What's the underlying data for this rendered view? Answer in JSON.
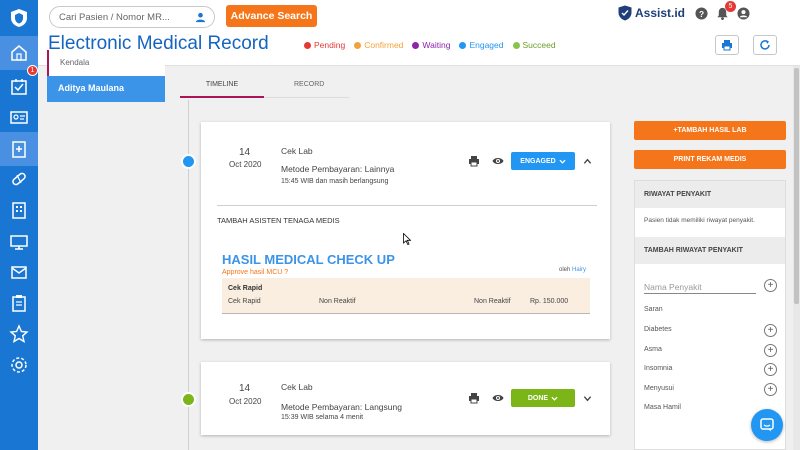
{
  "app": {
    "brand": "Assist.id"
  },
  "search": {
    "placeholder": "Cari Pasien / Nomor MR..."
  },
  "header": {
    "advance_search_label": "Advance Search",
    "title": "Electronic Medical Record",
    "legend": [
      {
        "label": "Pending",
        "color": "#e53935"
      },
      {
        "label": "Confirmed",
        "color": "#f5a13b"
      },
      {
        "label": "Waiting",
        "color": "#8e24aa"
      },
      {
        "label": "Engaged",
        "color": "#2196f3"
      },
      {
        "label": "Succeed",
        "color": "#8bc34a"
      }
    ],
    "notification_count": "5"
  },
  "sidebar": {
    "checklist_badge": "1"
  },
  "patients": [
    {
      "name": "Kendala"
    },
    {
      "name": "Aditya Maulana"
    }
  ],
  "tabs": [
    {
      "label": "TIMELINE"
    },
    {
      "label": "RECORD"
    }
  ],
  "visits": [
    {
      "day": "14",
      "month_year": "Oct 2020",
      "title": "Cek Lab",
      "payment": "Metode Pembayaran: Lainnya",
      "time_note": "15:45 WIB dan masih berlangsung",
      "status": "ENGAGED",
      "status_color": "#2196f3",
      "assist_label": "TAMBAH ASISTEN TENAGA MEDIS",
      "mcu": {
        "title": "HASIL MEDICAL CHECK UP",
        "approve": "Approve hasil MCU ?",
        "by_label": "oleh",
        "by_name": "Hairy",
        "header": "Cek Rapid",
        "row": {
          "test": "Cek Rapid",
          "result": "Non Reaktif",
          "reference": "Non Reaktif",
          "price": "Rp. 150.000"
        }
      }
    },
    {
      "day": "14",
      "month_year": "Oct 2020",
      "title": "Cek Lab",
      "payment": "Metode Pembayaran: Langsung",
      "time_note": "15:39 WIB selama 4 menit",
      "status": "DONE",
      "status_color": "#7cb518"
    }
  ],
  "right_panel": {
    "add_result_label": "+TAMBAH HASIL LAB",
    "print_label": "PRINT REKAM MEDIS",
    "history_title": "RIWAYAT PENYAKIT",
    "history_empty": "Pasien tidak memiliki riwayat penyakit.",
    "add_history_title": "TAMBAH RIWAYAT PENYAKIT",
    "disease_placeholder": "Nama Penyakit",
    "suggestion_label": "Saran",
    "suggestions": [
      "Diabetes",
      "Asma",
      "Insomnia",
      "Menyusui",
      "Masa Hamil"
    ]
  }
}
